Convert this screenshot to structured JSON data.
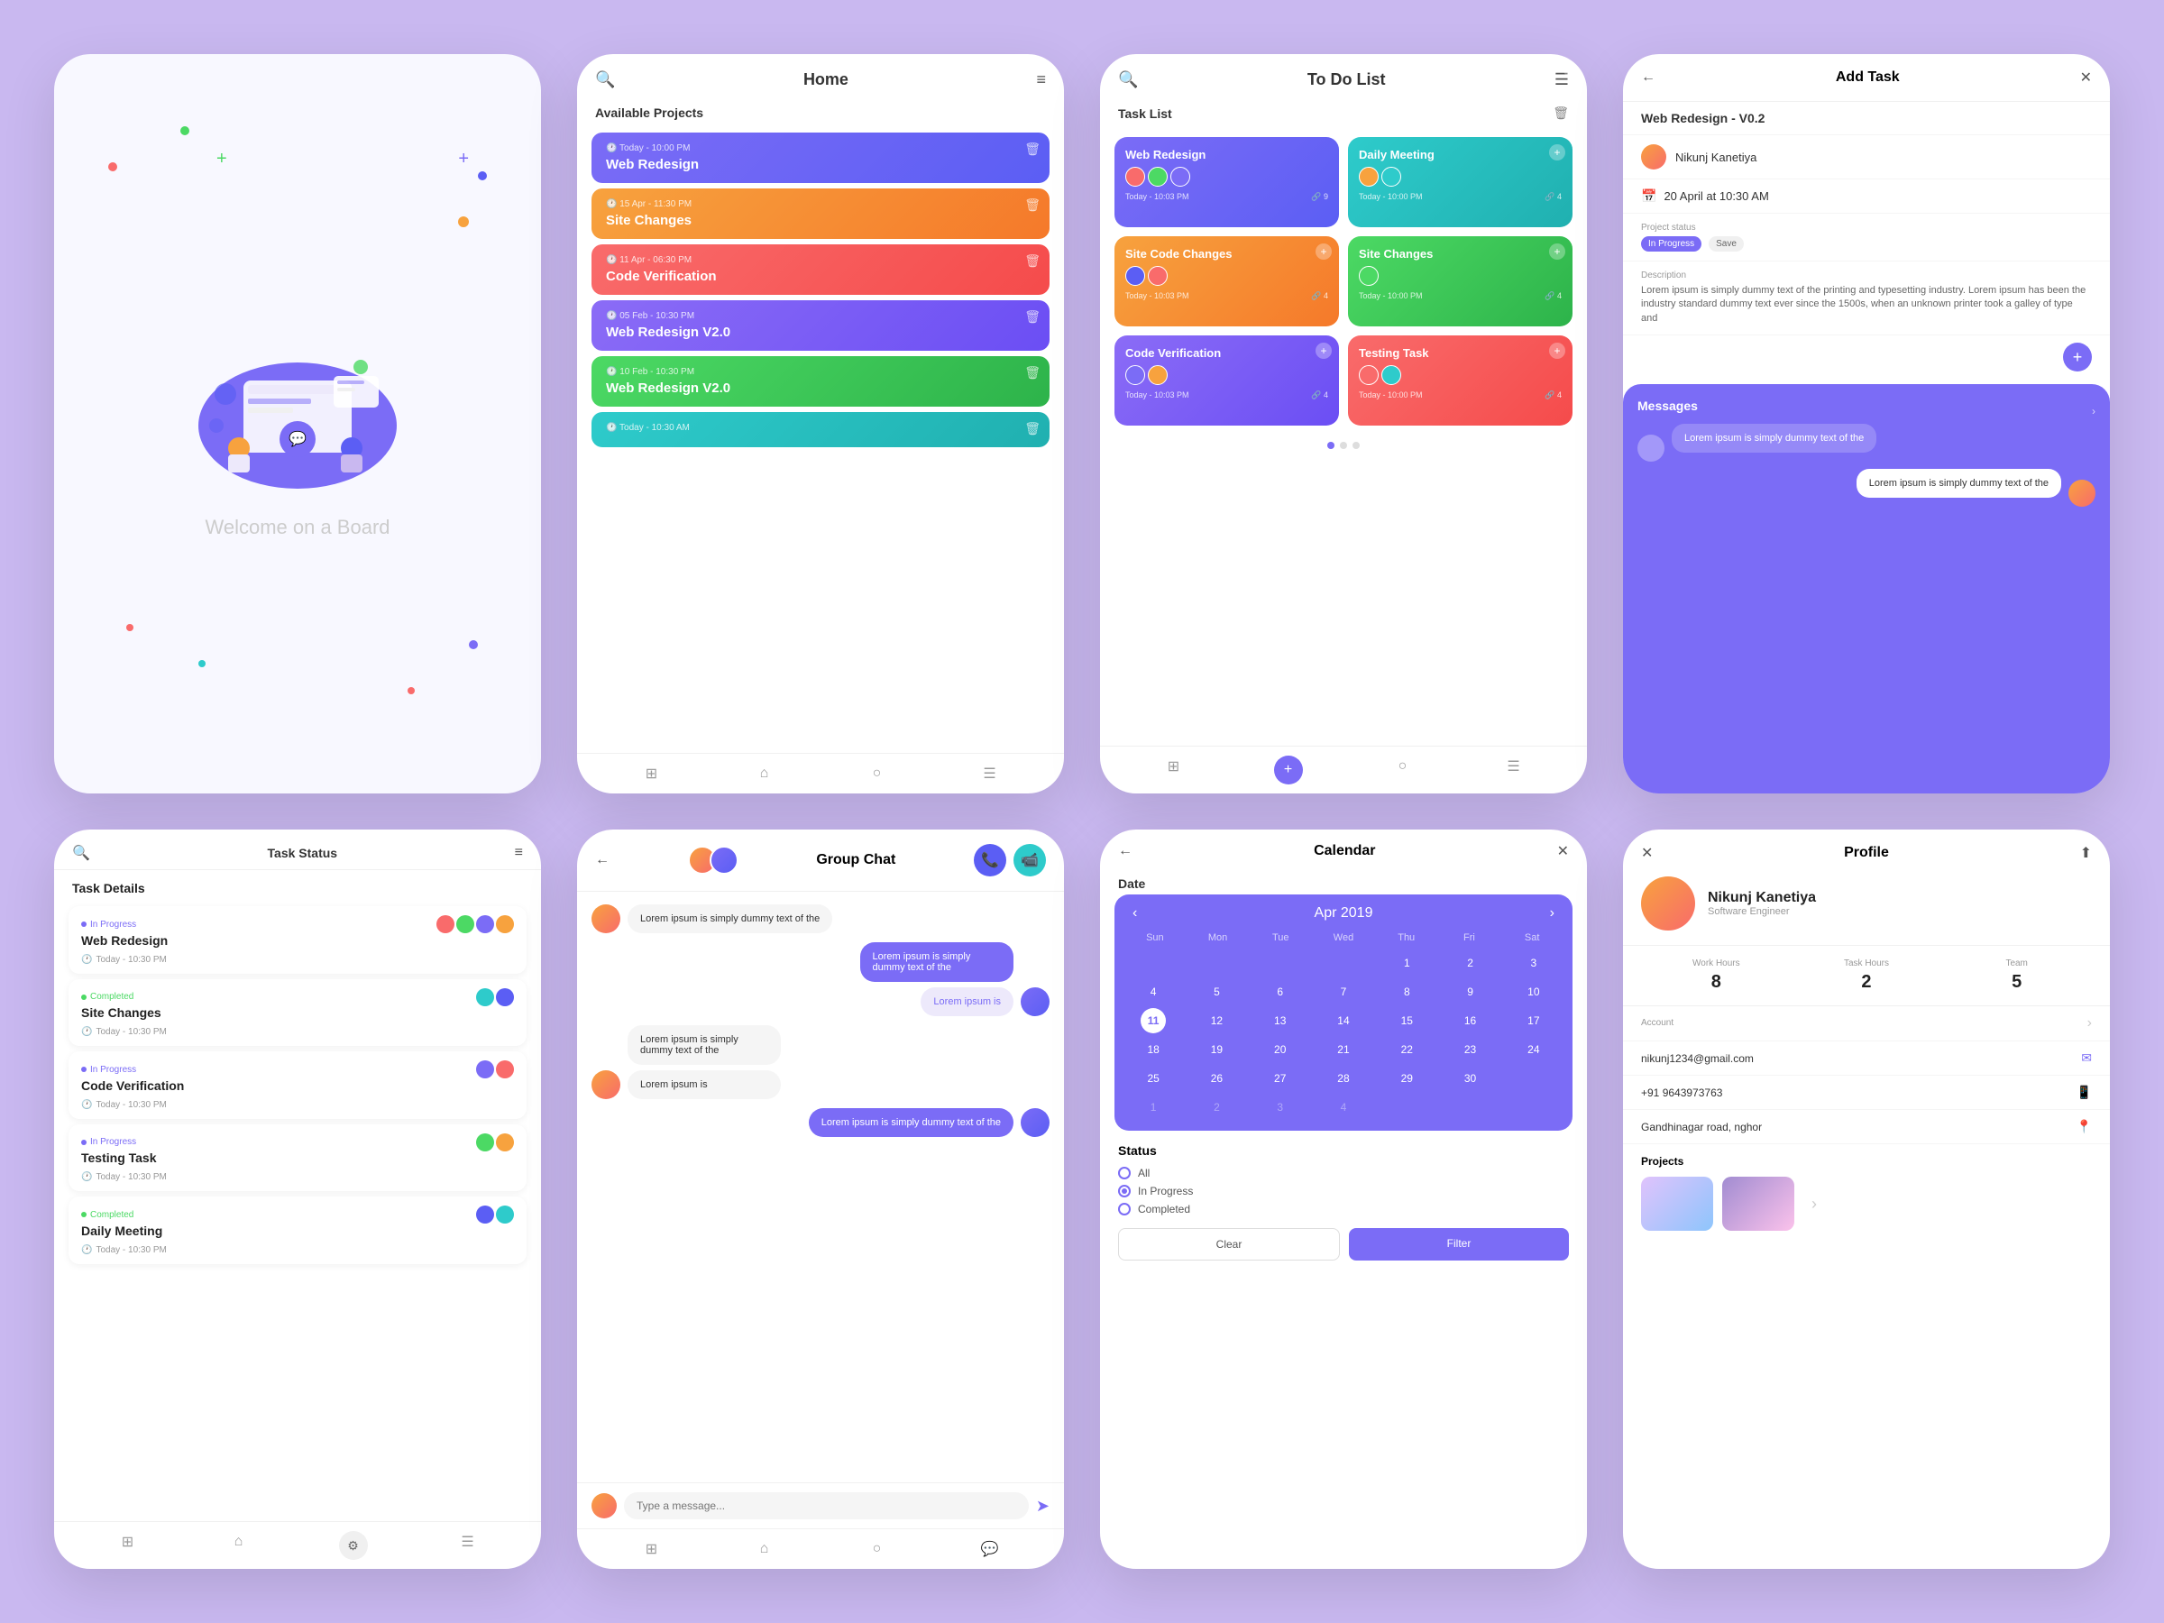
{
  "bg": "#c9b8f0",
  "screens": {
    "welcome": {
      "text": "Welcome on a Board"
    },
    "home": {
      "title": "Home",
      "section": "Available Projects",
      "projects": [
        {
          "meta": "Today - 10:00 PM",
          "title": "Web Redesign",
          "color": "card-blue"
        },
        {
          "meta": "15 Apr - 11:30 PM",
          "title": "Site Changes",
          "color": "card-orange"
        },
        {
          "meta": "11 Apr - 06:30 PM",
          "title": "Code Verification",
          "color": "card-red"
        },
        {
          "meta": "05 Feb - 10:30 PM",
          "title": "Web Redesign V2.0",
          "color": "card-purple"
        },
        {
          "meta": "10 Feb - 10:30 PM",
          "title": "Web Redesign V2.0",
          "color": "card-green"
        },
        {
          "meta": "Today - 10:30 AM",
          "title": "",
          "color": "card-teal"
        }
      ]
    },
    "todo": {
      "title": "To Do List",
      "section": "Task List",
      "tasks": [
        {
          "title": "Web Redesign",
          "color": "card-blue",
          "meta": "Today - 10:03 PM"
        },
        {
          "title": "Daily Meeting",
          "color": "card-teal",
          "meta": "Today - 10:00 PM"
        },
        {
          "title": "Site Code Changes",
          "color": "card-orange",
          "meta": "Today - 10:03 PM"
        },
        {
          "title": "Site Changes",
          "color": "card-green",
          "meta": "Today - 10:00 PM"
        },
        {
          "title": "Code Verification",
          "color": "card-purple",
          "meta": "Today - 10:03 PM"
        },
        {
          "title": "Testing Task",
          "color": "card-red",
          "meta": "Today - 10:00 PM"
        }
      ]
    },
    "addtask": {
      "title": "Add Task",
      "project": "Web Redesign - V0.2",
      "assignee": "Nikunj Kanetiya",
      "date": "20 April at 10:30 AM",
      "status_label": "Project status",
      "status_value": "In Progress",
      "save_label": "Save",
      "desc_label": "Description",
      "desc_text": "Lorem ipsum is simply dummy text of the printing and typesetting industry. Lorem ipsum has been the industry standard dummy text ever since the 1500s, when an unknown printer took a galley of type and",
      "messages_label": "Messages",
      "msg1": "Lorem ipsum is simply dummy text of the",
      "msg2": "Lorem ipsum is simply dummy text of the"
    },
    "taskstatus": {
      "title": "Task Status",
      "section": "Task Details",
      "items": [
        {
          "status": "In Progress",
          "title": "Web Redesign",
          "time": "Today - 10:30 PM",
          "color": "dot-purple"
        },
        {
          "status": "Completed",
          "title": "Site Changes",
          "time": "Today - 10:30 PM",
          "color": "dot-green"
        },
        {
          "status": "In Progress",
          "title": "Code Verification",
          "time": "Today - 10:30 PM",
          "color": "dot-purple"
        },
        {
          "status": "In Progress",
          "title": "Testing Task",
          "time": "Today - 10:30 PM",
          "color": "dot-purple"
        },
        {
          "status": "Completed",
          "title": "Daily Meeting",
          "time": "Today - 10:30 PM",
          "color": "dot-green"
        }
      ]
    },
    "groupchat": {
      "title": "Group Chat",
      "messages": [
        {
          "side": "received",
          "text": "Lorem ipsum is simply dummy text of the",
          "has_avatar": true
        },
        {
          "side": "sent",
          "text": "Lorem ipsum is simply dummy text of the",
          "has_avatar": true
        },
        {
          "side": "sent2",
          "text": "Lorem ipsum is",
          "has_avatar": false
        },
        {
          "side": "received",
          "text": "Lorem ipsum is simply dummy text of the",
          "has_avatar": true
        },
        {
          "side": "received2",
          "text": "Lorem ipsum is",
          "has_avatar": false
        },
        {
          "side": "sent",
          "text": "Lorem ipsum is simply dummy text of the",
          "has_avatar": true
        }
      ],
      "input_placeholder": "Type a message..."
    },
    "calendar": {
      "title": "Calendar",
      "date_label": "Date",
      "month": "Apr 2019",
      "days": [
        "Sun",
        "Mon",
        "Tue",
        "Wed",
        "Thu",
        "Fri",
        "Sat"
      ],
      "weeks": [
        [
          "",
          "",
          "",
          "",
          "1",
          "2",
          "3"
        ],
        [
          "4",
          "5",
          "6",
          "7",
          "8",
          "9",
          "10"
        ],
        [
          "11",
          "12",
          "13",
          "14",
          "15",
          "16",
          "17"
        ],
        [
          "18",
          "19",
          "20",
          "21",
          "22",
          "23",
          "24"
        ],
        [
          "25",
          "26",
          "27",
          "28",
          "29",
          "30",
          ""
        ],
        [
          "1",
          "2",
          "3",
          "4",
          "",
          "",
          ""
        ]
      ],
      "today": "11",
      "status_label": "Status",
      "radio_all": "All",
      "radio_inprogress": "In Progress",
      "radio_completed": "Completed",
      "btn_clear": "Clear",
      "btn_filter": "Filter"
    },
    "profile": {
      "title": "Profile",
      "name": "Nikunj Kanetiya",
      "sub": "Software Engineer",
      "work_hours_label": "Work Hours",
      "work_hours": "8",
      "task_hours_label": "Task Hours",
      "task_hours": "2",
      "team_label": "Team",
      "team": "5",
      "account_label": "Account",
      "email": "nikunj1234@gmail.com",
      "phone": "+91 9643973763",
      "address": "Gandhinagar road, nghor",
      "projects_label": "Projects"
    }
  }
}
